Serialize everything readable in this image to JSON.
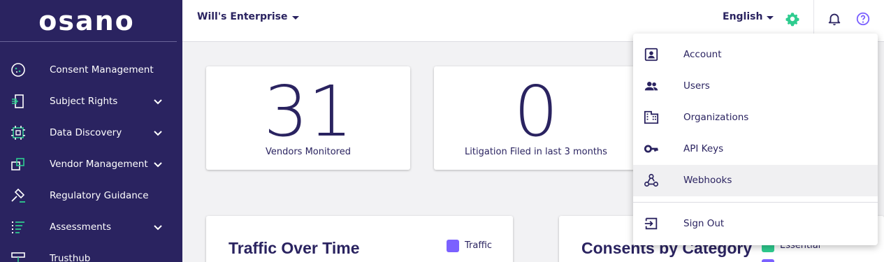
{
  "brand": {
    "logo_text": "osano"
  },
  "sidebar": {
    "items": [
      {
        "label": "Consent Management",
        "icon": "consent-icon",
        "expandable": false
      },
      {
        "label": "Subject Rights",
        "icon": "subject-rights-icon",
        "expandable": true
      },
      {
        "label": "Data Discovery",
        "icon": "data-discovery-icon",
        "expandable": true
      },
      {
        "label": "Vendor Management",
        "icon": "vendor-icon",
        "expandable": true
      },
      {
        "label": "Regulatory Guidance",
        "icon": "gavel-icon",
        "expandable": false
      },
      {
        "label": "Assessments",
        "icon": "assessments-icon",
        "expandable": true
      },
      {
        "label": "Trusthub",
        "icon": "trusthub-icon",
        "expandable": false
      }
    ]
  },
  "topbar": {
    "organization": "Will's Enterprise",
    "language": "English"
  },
  "stats": [
    {
      "value": "31",
      "label": "Vendors Monitored"
    },
    {
      "value": "0",
      "label": "Litigation Filed in last 3 months"
    }
  ],
  "traffic_chart": {
    "title": "Traffic Over Time",
    "legend": [
      "Traffic"
    ]
  },
  "consents_chart": {
    "title": "Consents by Category",
    "legend": [
      "Essential"
    ]
  },
  "dropdown": {
    "items": [
      {
        "label": "Account",
        "icon": "account-icon"
      },
      {
        "label": "Users",
        "icon": "users-icon"
      },
      {
        "label": "Organizations",
        "icon": "organizations-icon"
      },
      {
        "label": "API Keys",
        "icon": "key-icon"
      },
      {
        "label": "Webhooks",
        "icon": "webhooks-icon"
      }
    ],
    "sign_out": {
      "label": "Sign Out",
      "icon": "sign-out-icon"
    }
  },
  "colors": {
    "sidebar_bg": "#2a2360",
    "accent_green": "#2ecc8f",
    "accent_purple": "#7b61ff",
    "text_navy": "#2a2360"
  }
}
